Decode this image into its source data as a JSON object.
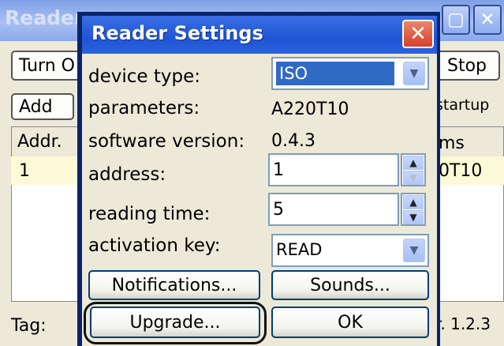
{
  "background_window": {
    "title": "Reader",
    "turn_button": "Turn O",
    "stop_button": "Stop",
    "add_button": "Add",
    "startup_label": "startup",
    "columns": [
      "Addr.",
      "ms"
    ],
    "row": {
      "addr": "1",
      "type": "0T10"
    },
    "tag_label": "Tag:",
    "version_text": "r.  1.2.3"
  },
  "dialog": {
    "title": "Reader Settings",
    "close_glyph": "✕",
    "fields": {
      "device_type_label": "device type:",
      "device_type_value": "ISO",
      "parameters_label": "parameters:",
      "parameters_value": "A220T10",
      "software_version_label": "software version:",
      "software_version_value": "0.4.3",
      "address_label": "address:",
      "address_value": "1",
      "reading_time_label": "reading time:",
      "reading_time_value": "5",
      "activation_key_label": "activation key:",
      "activation_key_value": "READ"
    },
    "buttons": {
      "notifications": "Notifications...",
      "sounds": "Sounds...",
      "upgrade": "Upgrade...",
      "ok": "OK"
    }
  },
  "icons": {
    "dropdown": "chevron-down-icon",
    "spin_up": "arrow-up-icon",
    "spin_down": "arrow-down-icon"
  },
  "colors": {
    "title_bar": "#1f55d6",
    "selection": "#316ac5",
    "dialog_bg": "#ece9d8",
    "close_button": "#d8402a"
  }
}
